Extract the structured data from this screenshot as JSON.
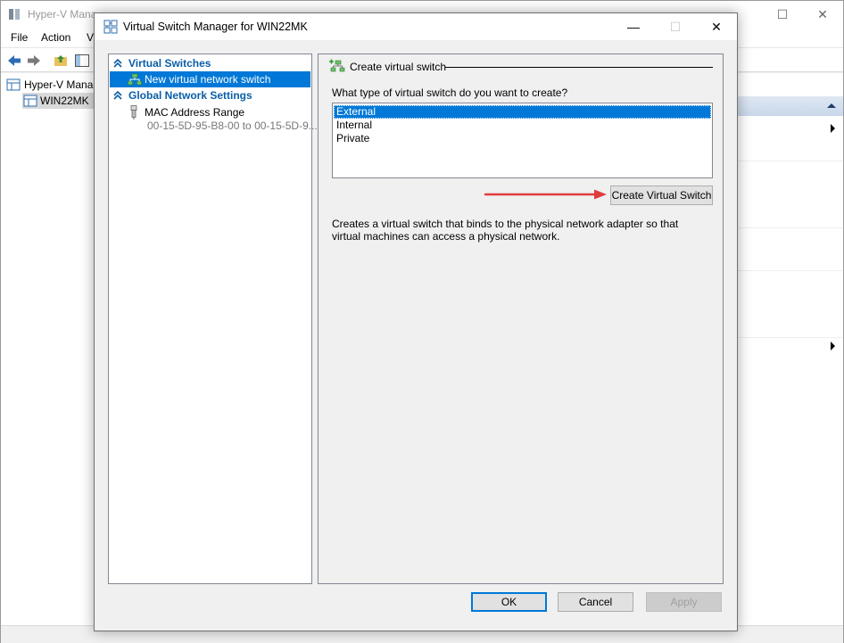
{
  "background_window": {
    "title": "Hyper-V Mana",
    "menu": [
      "File",
      "Action",
      "Vi"
    ],
    "tree": {
      "root": "Hyper-V Manag",
      "server": "WIN22MK"
    }
  },
  "dialog": {
    "title": "Virtual Switch Manager for WIN22MK",
    "left_pane": {
      "virtual_switches_header": "Virtual Switches",
      "new_switch_item": "New virtual network switch",
      "global_settings_header": "Global Network Settings",
      "mac_range_label": "MAC Address Range",
      "mac_range_value": "00-15-5D-95-B8-00 to 00-15-5D-9..."
    },
    "right_pane": {
      "group_title": "Create virtual switch",
      "question": "What type of virtual switch do you want to create?",
      "switch_types": [
        {
          "label": "External",
          "selected": true
        },
        {
          "label": "Internal",
          "selected": false
        },
        {
          "label": "Private",
          "selected": false
        }
      ],
      "create_button": "Create Virtual Switch",
      "description": "Creates a virtual switch that binds to the physical network adapter so that virtual machines can access a physical network."
    },
    "buttons": {
      "ok": "OK",
      "cancel": "Cancel",
      "apply": "Apply"
    }
  },
  "colors": {
    "selection": "#0078d7",
    "header_blue": "#0a5ea8",
    "annotation_arrow": "#e03c3c"
  }
}
